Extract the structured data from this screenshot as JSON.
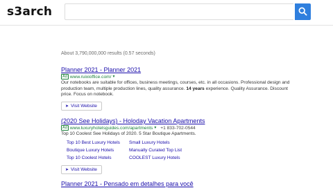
{
  "header": {
    "logo": "s3arch",
    "search_value": "",
    "search_icon": "search-icon"
  },
  "results_count": "About 3,790,000,000 results (0.57 seconds)",
  "results": [
    {
      "title": "Planner 2021 - Planner 2021",
      "ad_label": "Ad",
      "url": "www.ruixioffice.com/",
      "desc_part1": "Our notebooks are suitable for offices, business meetings, courses, etc. in all occasions. Professional design and production team, multiple production lines, quality assurance. ",
      "desc_bold": "14 years",
      "desc_part2": " experience. Quality Assurance. Discount price. Focus on notebook.",
      "visit_label": "Visit Website"
    },
    {
      "title": "(2020 See Holidays) - Holoday Vacation Apartments",
      "ad_label": "Ad",
      "url": "www.luxuryhotelsguides.com/apartments",
      "phone": "+1 833-702-0544",
      "desc": "Top 10 Coolest See Holidays of 2020. 5 Star Boutique Apartments.",
      "sitelinks": [
        "Top 10 Best Luxury Hotels",
        "Small Luxury Hotels",
        "Boutique Luxury Hotels",
        "Manually Curated Top List",
        "Top 10 Coolest Hotels",
        "COOLEST Luxury Hotels"
      ],
      "visit_label": "Visit Website"
    },
    {
      "title": "Planner 2021 - Pensado em detalhes para você"
    }
  ],
  "colors": {
    "link": "#1a0dab",
    "url_green": "#1a7f3b",
    "search_button": "#2f7fde"
  }
}
